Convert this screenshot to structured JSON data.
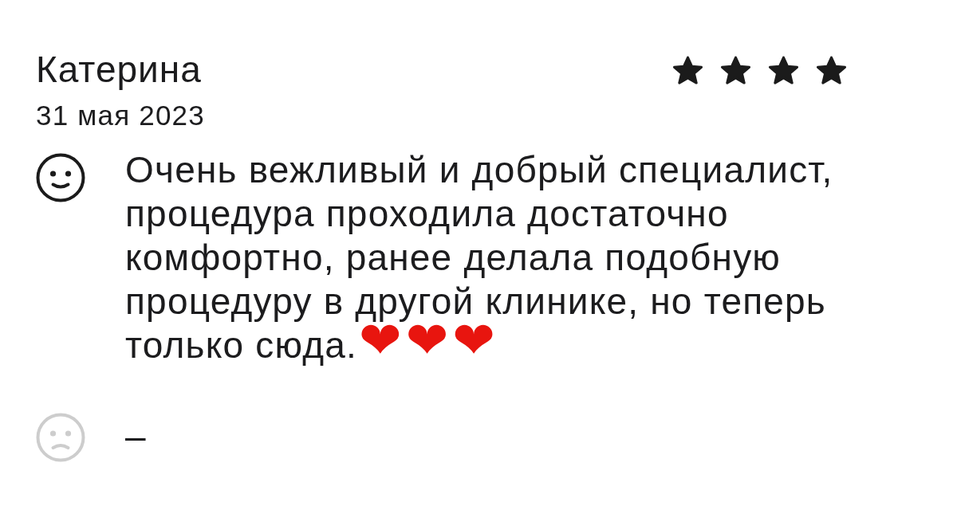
{
  "review": {
    "author": "Катерина",
    "date": "31 мая 2023",
    "stars": 4,
    "sections": [
      {
        "kind": "positive",
        "text": "Очень вежливый и добрый специалист, процедура проходила достаточно комфортно, ранее делала подобную процедуру в другой клинике, но теперь только сюда.",
        "emoji": [
          "❤",
          "❤",
          "❤"
        ]
      },
      {
        "kind": "negative",
        "text": "–"
      }
    ]
  }
}
